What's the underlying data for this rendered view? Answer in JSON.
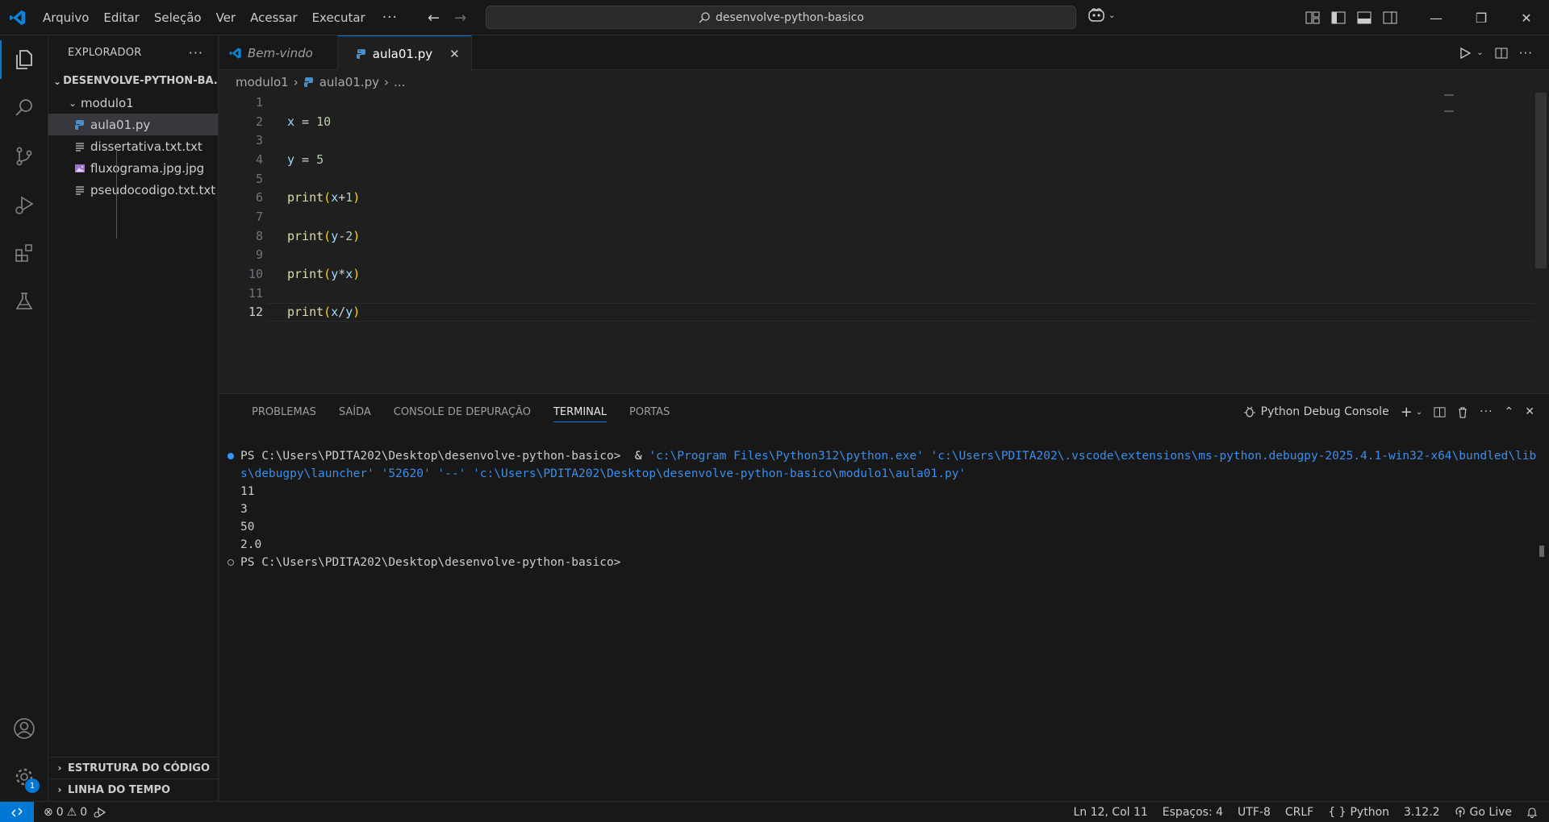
{
  "menu": [
    "Arquivo",
    "Editar",
    "Seleção",
    "Ver",
    "Acessar",
    "Executar"
  ],
  "menu_more": "···",
  "command_center": {
    "text": "desenvolve-python-basico"
  },
  "sidebar": {
    "title": "EXPLORADOR",
    "more": "···",
    "root": "DESENVOLVE-PYTHON-BA...",
    "folder": "modulo1",
    "files": [
      {
        "name": "aula01.py",
        "icon": "python-file-icon"
      },
      {
        "name": "dissertativa.txt.txt",
        "icon": "text-file-icon"
      },
      {
        "name": "fluxograma.jpg.jpg",
        "icon": "image-file-icon"
      },
      {
        "name": "pseudocodigo.txt.txt",
        "icon": "text-file-icon"
      }
    ],
    "outline": "ESTRUTURA DO CÓDIGO",
    "timeline": "LINHA DO TEMPO"
  },
  "tabs": [
    {
      "label": "Bem-vindo"
    },
    {
      "label": "aula01.py",
      "close": "✕"
    }
  ],
  "breadcrumb": {
    "folder": "modulo1",
    "file": "aula01.py",
    "more": "..."
  },
  "code": {
    "line_numbers": [
      "1",
      "2",
      "3",
      "4",
      "5",
      "6",
      "7",
      "8",
      "9",
      "10",
      "11",
      "12"
    ],
    "lines": [
      [],
      [
        [
          "var",
          "x"
        ],
        [
          "op",
          " = "
        ],
        [
          "num",
          "10"
        ]
      ],
      [],
      [
        [
          "var",
          "y"
        ],
        [
          "op",
          " = "
        ],
        [
          "num",
          "5"
        ]
      ],
      [],
      [
        [
          "fn",
          "print"
        ],
        [
          "par",
          "("
        ],
        [
          "var",
          "x"
        ],
        [
          "op",
          "+"
        ],
        [
          "num",
          "1"
        ],
        [
          "par",
          ")"
        ]
      ],
      [],
      [
        [
          "fn",
          "print"
        ],
        [
          "par",
          "("
        ],
        [
          "var",
          "y"
        ],
        [
          "op",
          "-"
        ],
        [
          "num",
          "2"
        ],
        [
          "par",
          ")"
        ]
      ],
      [],
      [
        [
          "fn",
          "print"
        ],
        [
          "par",
          "("
        ],
        [
          "var",
          "y"
        ],
        [
          "op",
          "*"
        ],
        [
          "var",
          "x"
        ],
        [
          "par",
          ")"
        ]
      ],
      [],
      [
        [
          "fn",
          "print"
        ],
        [
          "par",
          "("
        ],
        [
          "var",
          "x"
        ],
        [
          "op",
          "/"
        ],
        [
          "var",
          "y"
        ],
        [
          "par",
          ")"
        ]
      ]
    ]
  },
  "panel": {
    "tabs": [
      "PROBLEMAS",
      "SAÍDA",
      "CONSOLE DE DEPURAÇÃO",
      "TERMINAL",
      "PORTAS"
    ],
    "active_tab": "TERMINAL",
    "terminal_name": "Python Debug Console",
    "terminal": {
      "prompt": "PS C:\\Users\\PDITA202\\Desktop\\desenvolve-python-basico> ",
      "amp": " & ",
      "command": "'c:\\Program Files\\Python312\\python.exe' 'c:\\Users\\PDITA202\\.vscode\\extensions\\ms-python.debugpy-2025.4.1-win32-x64\\bundled\\libs\\debugpy\\launcher' '52620' '--' 'c:\\Users\\PDITA202\\Desktop\\desenvolve-python-basico\\modulo1\\aula01.py'",
      "outputs": [
        "11",
        "3",
        "50",
        "2.0"
      ],
      "final_prompt": "PS C:\\Users\\PDITA202\\Desktop\\desenvolve-python-basico>"
    }
  },
  "statusbar": {
    "errors": "0",
    "warnings": "0",
    "position": "Ln 12, Col 11",
    "spaces": "Espaços: 4",
    "encoding": "UTF-8",
    "eol": "CRLF",
    "language": "Python",
    "language_prefix": "{ }",
    "version": "3.12.2",
    "golive": "Go Live"
  },
  "badge_count": "1",
  "colors": {
    "accent": "#0078d4",
    "background": "#1f1f1f",
    "sidebar": "#181818"
  }
}
